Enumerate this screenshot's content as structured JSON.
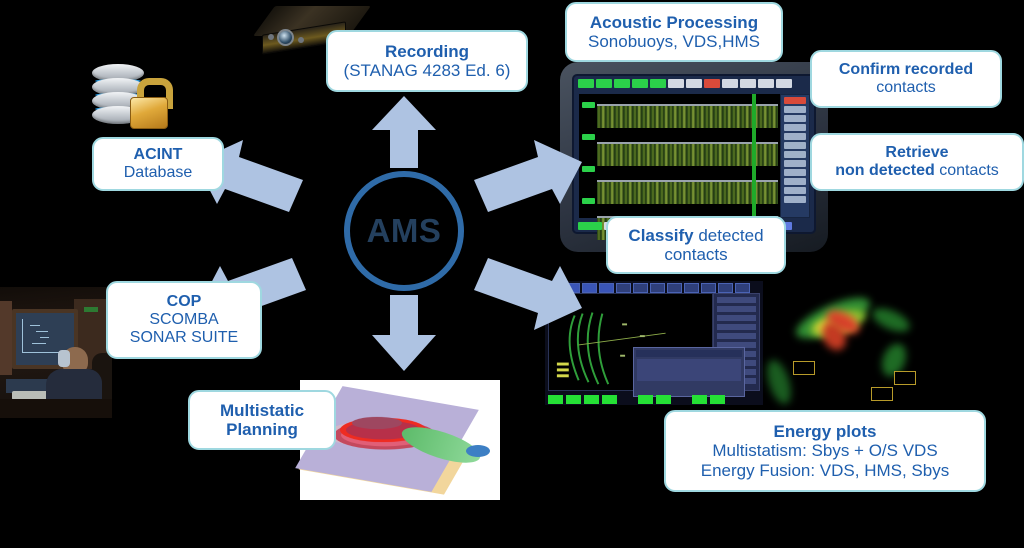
{
  "diagram": {
    "title": "AMS capability overview diagram",
    "hub": {
      "label": "AMS",
      "border_color": "#2f6ba8",
      "text_color": "#24405e"
    },
    "arrow_color": "#aec3e2",
    "bubble": {
      "border_color": "#9fd8e0",
      "text_color": "#1f5fae",
      "background": "#ffffff"
    },
    "callouts": [
      {
        "name": "recording",
        "lines": [
          {
            "text": "Recording",
            "bold": true
          },
          {
            "text": "(STANAG 4283 Ed. 6)",
            "bold": false
          }
        ]
      },
      {
        "name": "acoustic-processing",
        "lines": [
          {
            "text": "Acoustic Processing",
            "bold": true
          },
          {
            "text": "Sonobuoys, VDS,HMS",
            "bold": false
          }
        ]
      },
      {
        "name": "confirm-recorded-contacts",
        "lines": [
          {
            "text": "Confirm recorded",
            "bold": true
          },
          {
            "text": "contacts",
            "bold": false
          }
        ]
      },
      {
        "name": "retrieve-non-detected-contacts",
        "line1": "Retrieve",
        "line2_bold": "non detected",
        "line2_plain": " contacts"
      },
      {
        "name": "classify-detected-contacts",
        "line1_bold": "Classify",
        "line1_plain": " detected",
        "line2": "contacts"
      },
      {
        "name": "acint-database",
        "lines": [
          {
            "text": "ACINT",
            "bold": true
          },
          {
            "text": "Database",
            "bold": false
          }
        ]
      },
      {
        "name": "cop",
        "lines": [
          {
            "text": "COP",
            "bold": true
          },
          {
            "text": "SCOMBA",
            "bold": false
          },
          {
            "text": "SONAR SUITE",
            "bold": false
          }
        ]
      },
      {
        "name": "multistatic-planning",
        "lines": [
          {
            "text": "Multistatic",
            "bold": true
          },
          {
            "text": "Planning",
            "bold": true
          }
        ]
      },
      {
        "name": "energy-plots",
        "lines": [
          {
            "text": "Energy plots",
            "bold": true
          },
          {
            "text": "Multistatism: Sbys + O/S VDS",
            "bold": false
          },
          {
            "text": "Energy Fusion: VDS, HMS, Sbys",
            "bold": false
          }
        ]
      }
    ],
    "images": [
      {
        "name": "recorder-device-image",
        "description": "Dark 3D recording unit box"
      },
      {
        "name": "acint-database-icon",
        "description": "Database cylinder with gold padlock"
      },
      {
        "name": "operator-console-photo",
        "description": "Sonar operator with headphones at console"
      },
      {
        "name": "acoustic-processing-screenshot",
        "description": "Rugged display with four spectrogram bands"
      },
      {
        "name": "tactical-display-screenshot",
        "description": "Green bearing-time tracks with dialog window"
      },
      {
        "name": "energy-fusion-plot-image",
        "description": "Green red yellow energy blobs on black"
      },
      {
        "name": "multistatic-planning-3d-image",
        "description": "3D coverage rings on a plane with green lobe"
      }
    ],
    "arrows": [
      {
        "name": "arrow-up-recording",
        "direction": "up"
      },
      {
        "name": "arrow-up-left-acint",
        "direction": "up-left"
      },
      {
        "name": "arrow-up-right-acoustic",
        "direction": "up-right"
      },
      {
        "name": "arrow-down-left-cop",
        "direction": "down-left"
      },
      {
        "name": "arrow-down-right-energy",
        "direction": "down-right"
      },
      {
        "name": "arrow-down-multistatic",
        "direction": "down"
      }
    ]
  }
}
